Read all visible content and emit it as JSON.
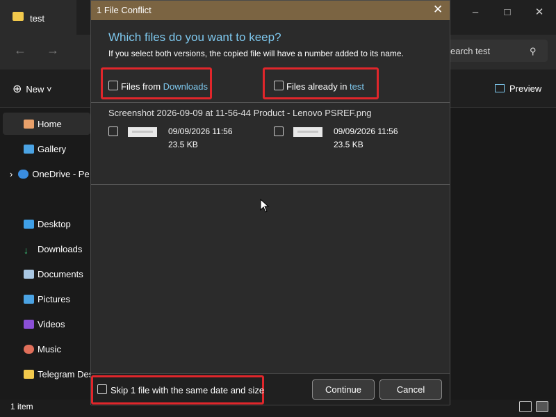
{
  "explorer": {
    "tab_title": "test",
    "search_text": "earch test",
    "new_label": "New",
    "preview_label": "Preview",
    "sidebar": [
      "Home",
      "Gallery",
      "OneDrive - Pe",
      "Desktop",
      "Downloads",
      "Documents",
      "Pictures",
      "Videos",
      "Music",
      "Telegram Desk"
    ],
    "status": "1 item"
  },
  "dialog": {
    "title": "1 File Conflict",
    "heading": "Which files do you want to keep?",
    "subtext": "If you select both versions, the copied file will have a number added to its name.",
    "option_left_prefix": "Files from ",
    "option_left_link": "Downloads",
    "option_right_prefix": "Files already in ",
    "option_right_link": "test",
    "file_name": "Screenshot 2026-09-09 at 11-56-44 Product - Lenovo PSREF.png",
    "left_file": {
      "date": "09/09/2026 11:56",
      "size": "23.5 KB"
    },
    "right_file": {
      "date": "09/09/2026 11:56",
      "size": "23.5 KB"
    },
    "skip_label": "Skip 1 file with the same date and size",
    "continue_label": "Continue",
    "cancel_label": "Cancel"
  },
  "colors": {
    "title_bar": "#7b6442",
    "accent": "#7ec8ee",
    "highlight": "#e0262b"
  }
}
